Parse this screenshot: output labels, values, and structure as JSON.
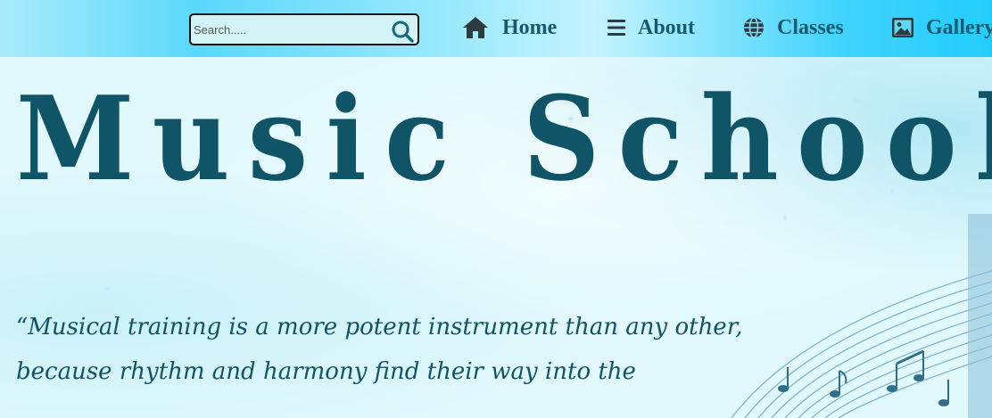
{
  "search": {
    "placeholder": "Search.....",
    "value": ""
  },
  "nav": {
    "home": "Home",
    "about": "About",
    "classes": "Classes",
    "gallery": "Gallery"
  },
  "hero": {
    "title": "Music School",
    "quote": "“Musical training is a more potent instrument than any other, because rhythm and harmony find their way into the"
  },
  "colors": {
    "nav_text": "#175a6e",
    "title": "#0f5467",
    "search_bg": "#d2f4f6"
  },
  "icons": [
    "search-icon",
    "home-icon",
    "menu-icon",
    "globe-icon",
    "image-icon",
    "music-notes-icon"
  ]
}
